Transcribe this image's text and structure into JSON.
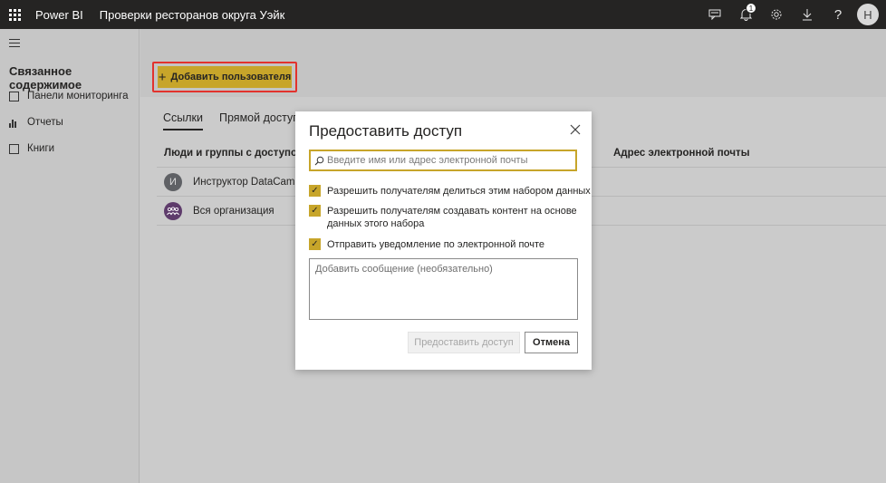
{
  "app": {
    "brand": "Power BI",
    "breadcrumb": "Проверки ресторанов округа Уэйк"
  },
  "topbar": {
    "icons": [
      "waffle-icon",
      "feedback-icon",
      "bell-icon",
      "gear-icon",
      "download-icon",
      "help-icon"
    ],
    "notification_count": "1",
    "avatar_initial": "Н"
  },
  "sidebar": {
    "title": "Связанное содержимое",
    "items": [
      {
        "label": "Панели мониторинга",
        "icon": "dashboard-icon"
      },
      {
        "label": "Отчеты",
        "icon": "report-icon"
      },
      {
        "label": "Книги",
        "icon": "workbook-icon"
      }
    ]
  },
  "main": {
    "add_user_label": "Добавить пользователя",
    "tabs": [
      {
        "label": "Ссылки",
        "active": true
      },
      {
        "label": "Прямой доступ",
        "active": false
      }
    ],
    "columns": {
      "people": "Люди и группы с доступом",
      "email": "Адрес электронной почты"
    },
    "rows": [
      {
        "initial": "И",
        "name": "Инструктор DataCamp"
      },
      {
        "initial": "",
        "name": "Вся организация"
      }
    ]
  },
  "dialog": {
    "title": "Предоставить доступ",
    "search_placeholder": "Введите имя или адрес электронной почты",
    "checkboxes": [
      {
        "label": "Разрешить получателям делиться этим набором данных",
        "checked": true
      },
      {
        "label_line1": "Разрешить получателям создавать контент на основе",
        "label_line2": "данных этого набора",
        "checked": true
      },
      {
        "label": "Отправить уведомление по электронной почте",
        "checked": true
      }
    ],
    "message_placeholder": "Добавить сообщение (необязательно)",
    "share_button": "Предоставить доступ",
    "cancel_button": "Отмена"
  },
  "colors": {
    "topbar": "#252423",
    "accent": "#c7a52a",
    "highlight_border": "#e2322d"
  }
}
